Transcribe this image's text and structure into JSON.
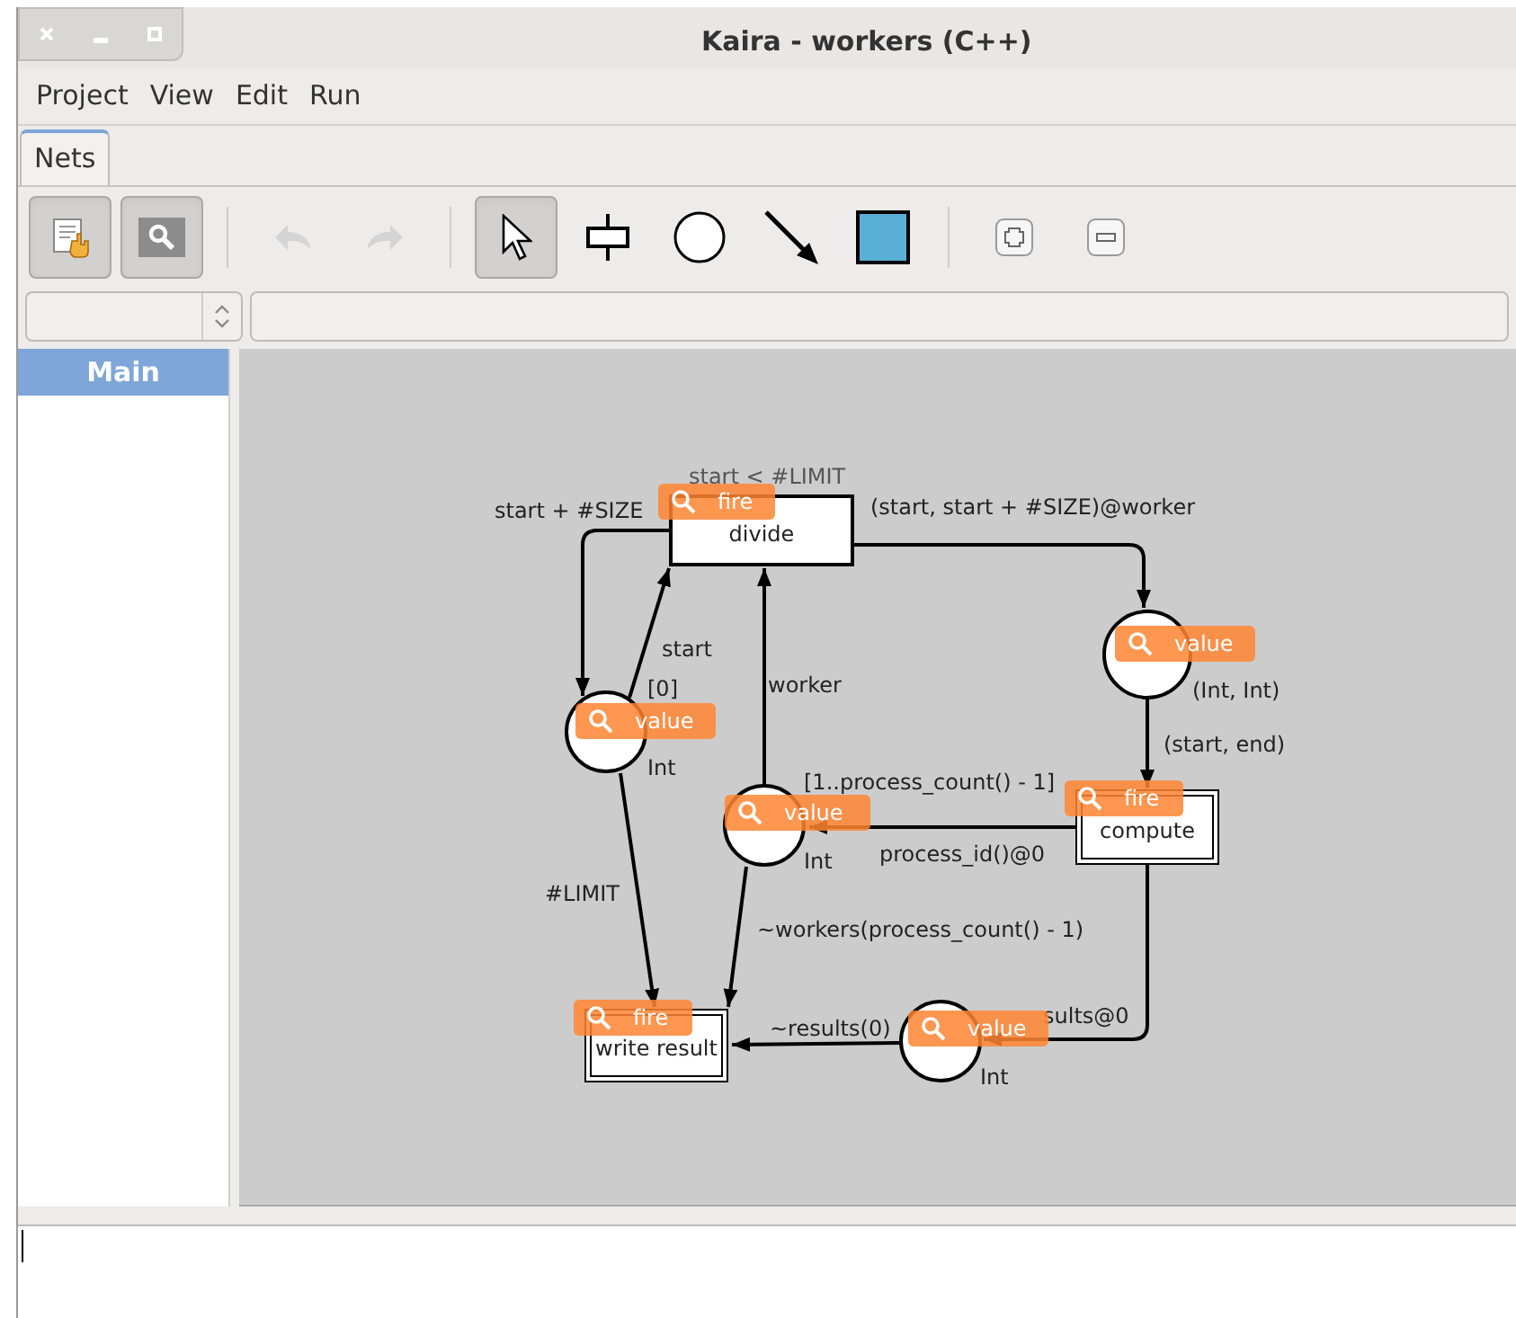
{
  "window": {
    "title": "Kaira - workers (C++)"
  },
  "menu": [
    {
      "label": "Project"
    },
    {
      "label": "View"
    },
    {
      "label": "Edit"
    },
    {
      "label": "Run"
    }
  ],
  "tabs": [
    {
      "label": "Nets",
      "selected": true
    }
  ],
  "toolbar": [
    {
      "kind": "edit",
      "selected": true
    },
    {
      "kind": "inspect",
      "selected": true
    },
    {
      "kind": "separator"
    },
    {
      "kind": "undo",
      "disabled": true
    },
    {
      "kind": "redo",
      "disabled": true
    },
    {
      "kind": "separator"
    },
    {
      "kind": "select",
      "selected": true
    },
    {
      "kind": "transition",
      "selected": false
    },
    {
      "kind": "place",
      "selected": false
    },
    {
      "kind": "arc",
      "selected": false
    },
    {
      "kind": "area",
      "selected": false
    },
    {
      "kind": "separator"
    },
    {
      "kind": "zoom-in"
    },
    {
      "kind": "zoom-out"
    }
  ],
  "sidebar": {
    "items": [
      {
        "label": "Main",
        "selected": true
      }
    ]
  },
  "net": {
    "transitions": [
      {
        "name": "divide",
        "guard": "start < #LIMIT",
        "badge": "fire",
        "kind": "single"
      },
      {
        "name": "compute",
        "badge": "fire",
        "kind": "double"
      },
      {
        "name": "write result",
        "badge": "fire",
        "kind": "double"
      }
    ],
    "places": [
      {
        "type": "(Int, Int)",
        "badge": "value"
      },
      {
        "type": "Int",
        "init": "[0]",
        "badge": "value"
      },
      {
        "type": "Int",
        "init": "[1..process_count() - 1]",
        "badge": "value"
      },
      {
        "type": "Int",
        "badge": "value"
      }
    ],
    "arcs": [
      {
        "label": "start + #SIZE"
      },
      {
        "label": "start"
      },
      {
        "label": "worker"
      },
      {
        "label": "(start, start + #SIZE)@worker"
      },
      {
        "label": "(start, end)"
      },
      {
        "label": "process_id()@0"
      },
      {
        "label": "sults@0"
      },
      {
        "label": "#LIMIT"
      },
      {
        "label": "~workers(process_count() - 1)"
      },
      {
        "label": "~results(0)"
      }
    ]
  }
}
